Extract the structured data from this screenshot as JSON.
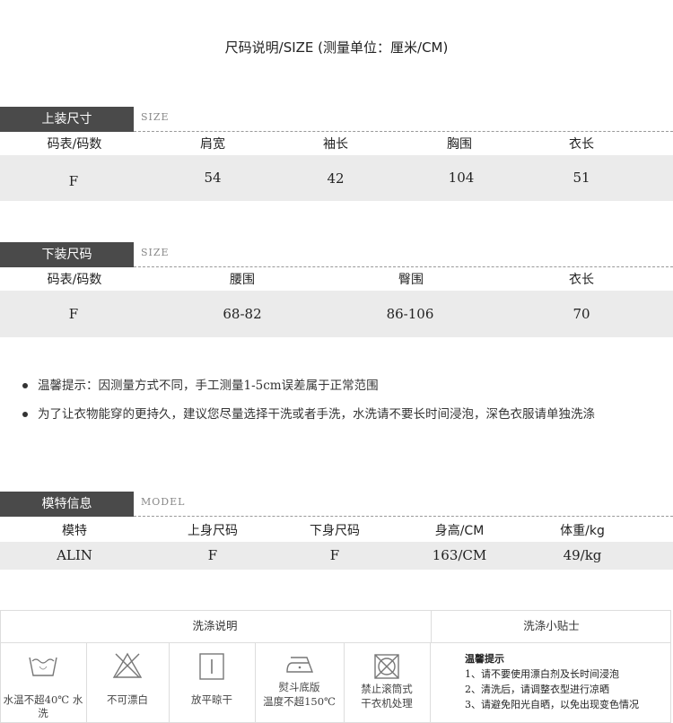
{
  "title": "尺码说明/SIZE (测量单位：厘米/CM)",
  "top_section": {
    "label": "上装尺寸",
    "sub": "SIZE",
    "headers": [
      "码表/码数",
      "肩宽",
      "袖长",
      "胸围",
      "衣长"
    ],
    "values": [
      "F",
      "54",
      "42",
      "104",
      "51"
    ]
  },
  "bottom_section": {
    "label": "下装尺码",
    "sub": "SIZE",
    "headers": [
      "码表/码数",
      "腰围",
      "臀围",
      "衣长"
    ],
    "values": [
      "F",
      "68-82",
      "86-106",
      "70"
    ]
  },
  "notes": [
    "温馨提示：因测量方式不同，手工测量1-5cm误差属于正常范围",
    "为了让衣物能穿的更持久，建议您尽量选择干洗或者手洗，水洗请不要长时间浸泡，深色衣服请单独洗涤"
  ],
  "model_section": {
    "label": "模特信息",
    "sub": "MODEL",
    "headers": [
      "模特",
      "上身尺码",
      "下身尺码",
      "身高/CM",
      "体重/kg"
    ],
    "values": [
      "ALIN",
      "F",
      "F",
      "163/CM",
      "49/kg"
    ]
  },
  "wash": {
    "left_title": "洗涤说明",
    "right_title": "洗涤小贴士",
    "icons": [
      {
        "icon": "wash-basin-icon",
        "caption1": "水温不超40℃ 水洗",
        "caption2": ""
      },
      {
        "icon": "no-bleach-icon",
        "caption1": "不可漂白",
        "caption2": ""
      },
      {
        "icon": "flat-dry-icon",
        "caption1": "放平晾干",
        "caption2": ""
      },
      {
        "icon": "iron-icon",
        "caption1": "熨斗底版",
        "caption2": "温度不超150℃"
      },
      {
        "icon": "no-tumble-dry-icon",
        "caption1": "禁止滚筒式",
        "caption2": "干衣机处理"
      }
    ],
    "tips_title": "温馨提示",
    "tips": [
      "1、请不要使用漂白剂及长时间浸泡",
      "2、清洗后，请调整衣型进行凉晒",
      "3、请避免阳光自晒，以免出现变色情况"
    ]
  }
}
